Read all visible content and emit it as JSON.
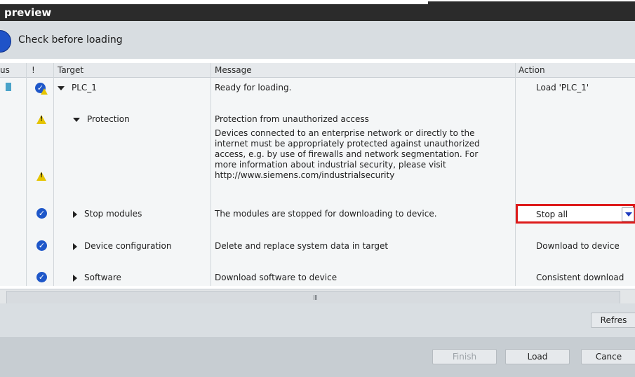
{
  "window": {
    "title": "preview"
  },
  "check": {
    "label": "Check before loading"
  },
  "columns": {
    "status": "us",
    "warn": "!",
    "target": "Target",
    "message": "Message",
    "action": "Action"
  },
  "rows": [
    {
      "target": "PLC_1",
      "message": "Ready for loading.",
      "action": "Load 'PLC_1'"
    },
    {
      "target": "Protection",
      "message": "Protection from unauthorized access"
    },
    {
      "message_lines": [
        "Devices connected to an enterprise network or directly to the",
        "internet must be appropriately protected against unauthorized",
        "access, e.g. by use of firewalls and network segmentation. For",
        "more information about industrial security, please visit",
        "http://www.siemens.com/industrialsecurity"
      ]
    },
    {
      "target": "Stop modules",
      "message": "The modules are stopped for downloading to device.",
      "action": "Stop all"
    },
    {
      "target": "Device configuration",
      "message": "Delete and replace system data in target",
      "action": "Download to device"
    },
    {
      "target": "Software",
      "message": "Download software to device",
      "action": "Consistent download"
    }
  ],
  "scroll": {
    "grip": "III"
  },
  "buttons": {
    "refresh": "Refres",
    "finish": "Finish",
    "load": "Load",
    "cancel": "Cance"
  },
  "colors": {
    "highlight": "#dd1b1b",
    "accent": "#1e57c9",
    "warning": "#e5c400"
  }
}
